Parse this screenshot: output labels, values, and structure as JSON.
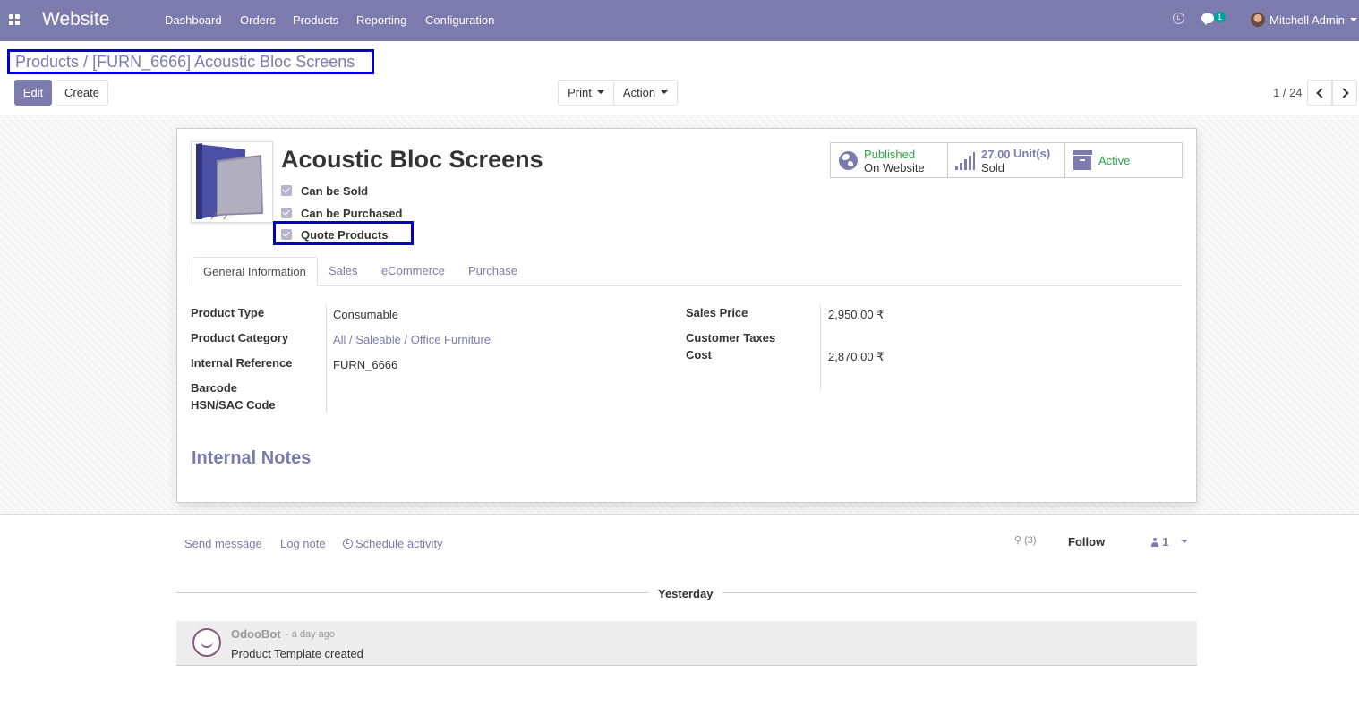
{
  "navbar": {
    "brand": "Website",
    "menu": [
      "Dashboard",
      "Orders",
      "Products",
      "Reporting",
      "Configuration"
    ],
    "messages_badge": "1",
    "user_name": "Mitchell Admin"
  },
  "breadcrumb": {
    "parent": "Products",
    "separator": "/",
    "current": "[FURN_6666] Acoustic Bloc Screens"
  },
  "toolbar": {
    "edit": "Edit",
    "create": "Create",
    "print": "Print",
    "action": "Action",
    "pager": "1 / 24"
  },
  "product": {
    "name": "Acoustic Bloc Screens",
    "checkboxes": [
      {
        "label": "Can be Sold",
        "checked": true
      },
      {
        "label": "Can be Purchased",
        "checked": true
      },
      {
        "label": "Quote Products",
        "checked": true
      }
    ]
  },
  "smart_buttons": {
    "published_status": "Published",
    "published_sub": "On Website",
    "sold_qty": "27.00",
    "sold_unit": "Unit(s)",
    "sold_label": "Sold",
    "active": "Active"
  },
  "tabs": [
    "General Information",
    "Sales",
    "eCommerce",
    "Purchase"
  ],
  "fields_left": [
    {
      "label": "Product Type",
      "value": "Consumable"
    },
    {
      "label": "Product Category",
      "value": "All / Saleable / Office Furniture"
    },
    {
      "label": "Internal Reference",
      "value": "FURN_6666"
    },
    {
      "label": "Barcode",
      "value": ""
    },
    {
      "label": "HSN/SAC Code",
      "value": ""
    }
  ],
  "fields_right": [
    {
      "label": "Sales Price",
      "value": "2,950.00 ₹"
    },
    {
      "label": "Customer Taxes",
      "value": ""
    },
    {
      "label": "Cost",
      "value": "2,870.00 ₹"
    }
  ],
  "notes_title": "Internal Notes",
  "chatter": {
    "send_message": "Send message",
    "log_note": "Log note",
    "schedule_activity": "Schedule activity",
    "attachments": "(3)",
    "follow": "Follow",
    "followers": "1",
    "day_separator": "Yesterday",
    "message": {
      "author": "OdooBot",
      "date": "- a day ago",
      "body": "Product Template created"
    }
  },
  "colors": {
    "brand": "#7c7bad",
    "published": "#28a745",
    "highlight_frame": "#0000cc"
  }
}
